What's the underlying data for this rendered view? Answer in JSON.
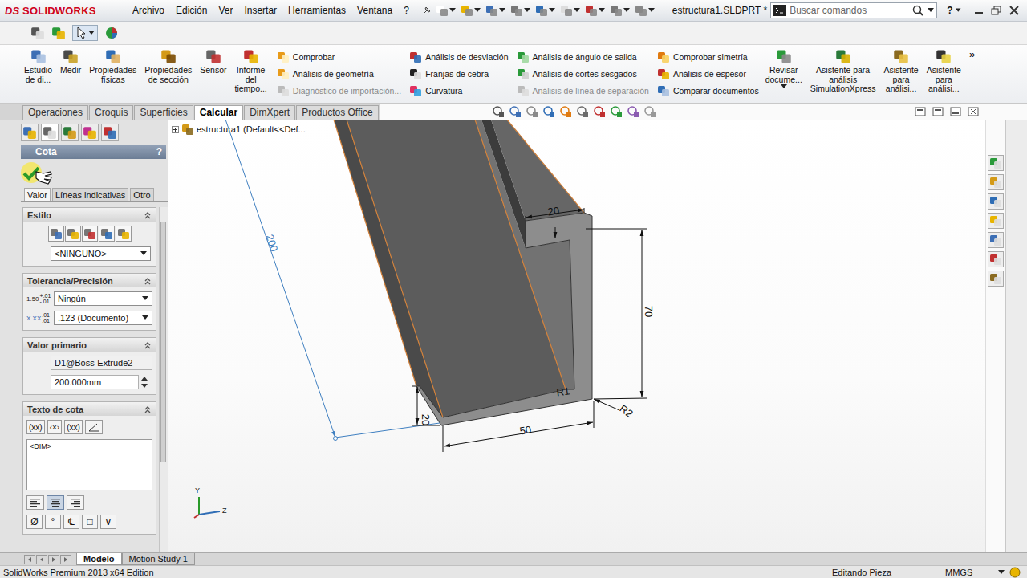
{
  "title_bar": {
    "logo_mark": "DS",
    "logo": "SOLIDWORKS",
    "menus": [
      "Archivo",
      "Edición",
      "Ver",
      "Insertar",
      "Herramientas",
      "Ventana",
      "?"
    ],
    "document": "estructura1.SLDPRT *",
    "search_placeholder": "Buscar comandos",
    "help": "?"
  },
  "ribbon": {
    "large_buttons": [
      {
        "lines": [
          "Estudio",
          "de di..."
        ]
      },
      {
        "lines": [
          "Medir"
        ]
      },
      {
        "lines": [
          "Propiedades",
          "físicas"
        ]
      },
      {
        "lines": [
          "Propiedades",
          "de sección"
        ]
      },
      {
        "lines": [
          "Sensor"
        ]
      },
      {
        "lines": [
          "Informe",
          "del",
          "tiempo..."
        ]
      }
    ],
    "columns": [
      [
        {
          "label": "Comprobar",
          "disabled": false
        },
        {
          "label": "Análisis de geometría",
          "disabled": false
        },
        {
          "label": "Diagnóstico de importación...",
          "disabled": true
        }
      ],
      [
        {
          "label": "Análisis de desviación",
          "disabled": false
        },
        {
          "label": "Franjas de cebra",
          "disabled": false
        },
        {
          "label": "Curvatura",
          "disabled": false
        }
      ],
      [
        {
          "label": "Análisis de ángulo de salida",
          "disabled": false
        },
        {
          "label": "Análisis de cortes sesgados",
          "disabled": false
        },
        {
          "label": "Análisis de línea de separación",
          "disabled": true
        }
      ],
      [
        {
          "label": "Comprobar simetría",
          "disabled": false
        },
        {
          "label": "Análisis de espesor",
          "disabled": false
        },
        {
          "label": "Comparar documentos",
          "disabled": false
        }
      ]
    ],
    "right_buttons": [
      {
        "lines": [
          "Revisar",
          "docume..."
        ]
      },
      {
        "lines": [
          "Asistente para",
          "análisis",
          "SimulationXpress"
        ]
      },
      {
        "lines": [
          "Asistente",
          "para",
          "análisi..."
        ]
      },
      {
        "lines": [
          "Asistente",
          "para",
          "análisi..."
        ]
      }
    ],
    "more": "»"
  },
  "tabs": [
    {
      "label": "Operaciones",
      "selected": false
    },
    {
      "label": "Croquis",
      "selected": false
    },
    {
      "label": "Superficies",
      "selected": false
    },
    {
      "label": "Calcular",
      "selected": true
    },
    {
      "label": "DimXpert",
      "selected": false
    },
    {
      "label": "Productos Office",
      "selected": false
    }
  ],
  "panel": {
    "title": "Cota",
    "help": "?",
    "tabs": [
      {
        "label": "Valor",
        "selected": true
      },
      {
        "label": "Líneas indicativas",
        "selected": false
      },
      {
        "label": "Otro",
        "selected": false
      }
    ],
    "style": {
      "title": "Estilo",
      "expanded": true,
      "dropdown": "<NINGUNO>"
    },
    "tolerance": {
      "title": "Tolerancia/Precisión",
      "expanded": true,
      "tolerance_icon": {
        "value": "1.50",
        "plus": "+.01",
        "minus": "-.01"
      },
      "tolerance": "Ningún",
      "precision_icon": {
        "value": "X.XX",
        "top": ".01",
        "bottom": ".01"
      },
      "precision": ".123 (Documento)"
    },
    "primary_value": {
      "title": "Valor primario",
      "expanded": true,
      "name": "D1@Boss-Extrude2",
      "value": "200.000mm"
    },
    "dim_text": {
      "title": "Texto de cota",
      "expanded": true,
      "buttons": [
        "(xx)",
        "‹×›",
        "(xx)"
      ],
      "text": "<DIM>",
      "align": [
        {
          "selected": false
        },
        {
          "selected": true
        },
        {
          "selected": false
        }
      ],
      "symbols": [
        "Ø",
        "°",
        "℄",
        "□",
        "∨"
      ]
    }
  },
  "tree": {
    "label": "estructura1  (Default<<Def...",
    "expanded": false
  },
  "model": {
    "dimensions": [
      {
        "text": "200",
        "selected": true
      },
      {
        "text": "20",
        "selected": false
      },
      {
        "text": "70",
        "selected": false
      },
      {
        "text": "R1",
        "selected": false
      },
      {
        "text": "R2",
        "selected": false
      },
      {
        "text": "50",
        "selected": false
      },
      {
        "text": "20",
        "selected": false
      }
    ],
    "axes": [
      "Y",
      "Z"
    ]
  },
  "bottom_tabs": [
    {
      "label": "Modelo",
      "selected": true
    },
    {
      "label": "Motion Study 1",
      "selected": false
    }
  ],
  "status_bar": {
    "product": "SolidWorks Premium 2013 x64 Edition",
    "mode": "Editando Pieza",
    "units": "MMGS"
  }
}
